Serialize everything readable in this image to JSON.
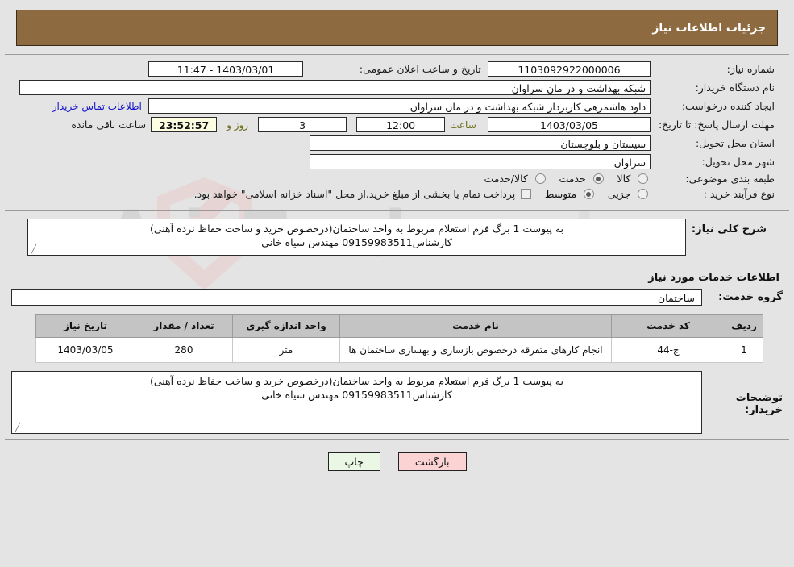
{
  "header": {
    "title": "جزئیات اطلاعات نیاز"
  },
  "form": {
    "need_number_label": "شماره نیاز:",
    "need_number_value": "1103092922000006",
    "announce_label": "تاریخ و ساعت اعلان عمومی:",
    "announce_value": "1403/03/01 - 11:47",
    "buyer_org_label": "نام دستگاه خریدار:",
    "buyer_org_value": "شبکه بهداشت و در مان سراوان",
    "creator_label": "ایجاد کننده درخواست:",
    "creator_value": "داود هاشمزهی  کاربرداز شبکه بهداشت و در مان سراوان",
    "contact_link": "اطلاعات تماس خریدار",
    "deadline_label": "مهلت ارسال پاسخ: تا تاریخ:",
    "deadline_date": "1403/03/05",
    "hour_label": "ساعت",
    "deadline_time": "12:00",
    "days_value": "3",
    "days_label": "روز و",
    "timer_value": "23:52:57",
    "remaining_label": "ساعت باقی مانده",
    "province_label": "استان محل تحویل:",
    "province_value": "سیستان و بلوچستان",
    "city_label": "شهر محل تحویل:",
    "city_value": "سراوان",
    "category_label": "طبقه بندی موضوعی:",
    "category_options": [
      "کالا",
      "خدمت",
      "کالا/خدمت"
    ],
    "category_selected": "خدمت",
    "process_label": "نوع فرآیند خرید :",
    "process_options": [
      "جزیی",
      "متوسط"
    ],
    "process_selected": "متوسط",
    "treasury_note": "پرداخت تمام یا بخشی از مبلغ خرید،از محل \"اسناد خزانه اسلامی\" خواهد بود."
  },
  "description": {
    "label": "شرح کلی نیاز:",
    "value": "به پیوست 1 برگ فرم استعلام مربوط به واحد ساختمان(درخصوص خرید و ساخت حفاظ نرده آهنی)\nکارشناس09159983511 مهندس سیاه خانی"
  },
  "services_section": {
    "title": "اطلاعات خدمات مورد نیاز",
    "group_label": "گروه خدمت:",
    "group_value": "ساختمان"
  },
  "table": {
    "headers": [
      "ردیف",
      "کد خدمت",
      "نام خدمت",
      "واحد اندازه گیری",
      "تعداد / مقدار",
      "تاریخ نیاز"
    ],
    "rows": [
      {
        "row": "1",
        "code": "ج-44",
        "name": "انجام کارهای متفرقه درخصوص بازسازی و بهسازی ساختمان ها",
        "unit": "متر",
        "qty": "280",
        "date": "1403/03/05"
      }
    ]
  },
  "buyer_notes": {
    "label": "توضیحات خریدار:",
    "value": "به پیوست 1 برگ فرم استعلام مربوط به واحد ساختمان(درخصوص خرید و ساخت حفاظ نرده آهنی)\nکارشناس09159983511 مهندس سیاه خانی"
  },
  "buttons": {
    "print": "چاپ",
    "back": "بازگشت"
  },
  "watermark": {
    "text_part1": "AriaTender",
    "text_part2": ".net"
  }
}
